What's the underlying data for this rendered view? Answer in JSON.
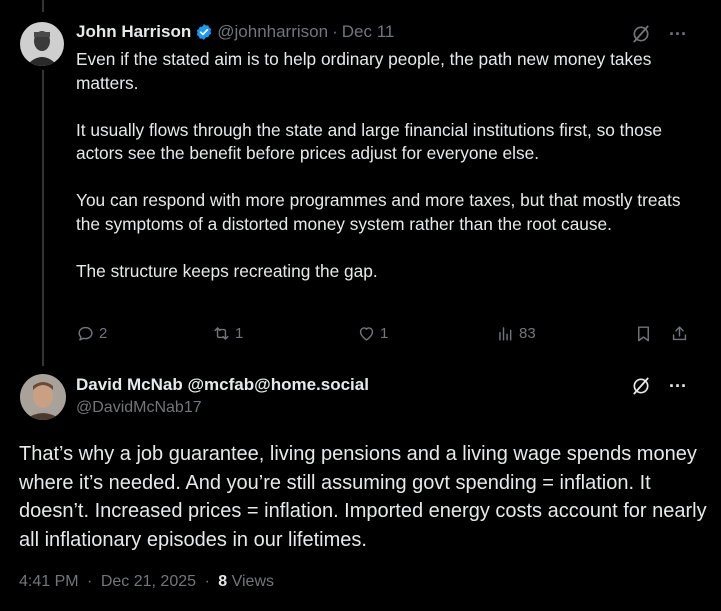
{
  "post1": {
    "author_name": "John Harrison",
    "handle": "@johnharrison",
    "separator": "·",
    "date": "Dec 11",
    "body": [
      "Even if the stated aim is to help ordinary people, the path new money takes matters.",
      "It usually flows through the state and large financial institutions first, so those actors see the benefit before prices adjust for everyone else.",
      "You can respond with more programmes and more taxes, but that mostly treats the symptoms of a distorted money system rather than the root cause.",
      "The structure keeps recreating the gap."
    ],
    "actions": {
      "replies": "2",
      "reposts": "1",
      "likes": "1",
      "views": "83"
    },
    "more_label": "···"
  },
  "post2": {
    "author_name": "David McNab @mcfab@home.social",
    "handle": "@DavidMcNab17",
    "body": "That’s why a job guarantee, living pensions and a living wage spends money where it’s needed. And you’re still assuming govt spending = inflation. It doesn’t. Increased prices = inflation. Imported energy costs account for nearly all inflationary episodes in our lifetimes.",
    "time": "4:41 PM",
    "separator": "·",
    "date": "Dec 21, 2025",
    "views_count": "8",
    "views_label": "Views",
    "more_label": "···"
  },
  "colors": {
    "background": "#000000",
    "text": "#e7e9ea",
    "muted": "#71767b",
    "verified_blue": "#1d9bf0"
  },
  "icons": [
    "verified-badge-icon",
    "grok-icon",
    "more-icon",
    "reply-icon",
    "repost-icon",
    "like-icon",
    "views-icon",
    "bookmark-icon",
    "share-icon"
  ]
}
